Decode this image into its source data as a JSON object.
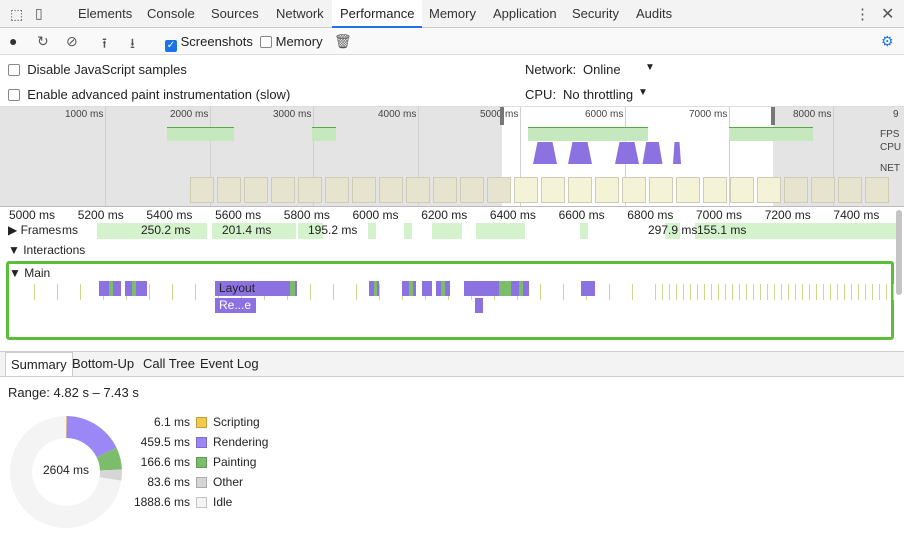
{
  "tabs": [
    "Elements",
    "Console",
    "Sources",
    "Network",
    "Performance",
    "Memory",
    "Application",
    "Security",
    "Audits"
  ],
  "active_tab": "Performance",
  "toolbar": {
    "screenshots_label": "Screenshots",
    "screenshots_checked": true,
    "memory_label": "Memory",
    "memory_checked": false
  },
  "settings": {
    "disable_js_samples": "Disable JavaScript samples",
    "advanced_paint": "Enable advanced paint instrumentation (slow)",
    "network_label": "Network:",
    "network_value": "Online",
    "cpu_label": "CPU:",
    "cpu_value": "No throttling"
  },
  "overview": {
    "ticks": [
      "1000 ms",
      "2000 ms",
      "3000 ms",
      "4000 ms",
      "5000 ms",
      "6000 ms",
      "7000 ms",
      "8000 ms",
      "9"
    ],
    "lanes": [
      "FPS",
      "CPU",
      "NET"
    ]
  },
  "ruler": [
    "5000 ms",
    "5200 ms",
    "5400 ms",
    "5600 ms",
    "5800 ms",
    "6000 ms",
    "6200 ms",
    "6400 ms",
    "6600 ms",
    "6800 ms",
    "7000 ms",
    "7200 ms",
    "7400 ms"
  ],
  "tracks": {
    "frames": "Frames",
    "interactions": "Interactions",
    "main": "Main"
  },
  "frames": [
    "ms",
    "250.2 ms",
    "201.4 ms",
    "195.2 ms",
    "297.9 ms",
    "155.1 ms"
  ],
  "flame_labels": [
    "Layout",
    "Re...e"
  ],
  "bottom_tabs": [
    "Summary",
    "Bottom-Up",
    "Call Tree",
    "Event Log"
  ],
  "summary": {
    "range": "Range: 4.82 s – 7.43 s",
    "total": "2604 ms",
    "items": [
      {
        "value": "6.1 ms",
        "ms": 6.1,
        "name": "Scripting",
        "color": "#f2c94c"
      },
      {
        "value": "459.5 ms",
        "ms": 459.5,
        "name": "Rendering",
        "color": "#9b87f5"
      },
      {
        "value": "166.6 ms",
        "ms": 166.6,
        "name": "Painting",
        "color": "#7cbd6b"
      },
      {
        "value": "83.6 ms",
        "ms": 83.6,
        "name": "Other",
        "color": "#d6d6d6"
      },
      {
        "value": "1888.6 ms",
        "ms": 1888.6,
        "name": "Idle",
        "color": "#f4f4f4"
      }
    ]
  }
}
